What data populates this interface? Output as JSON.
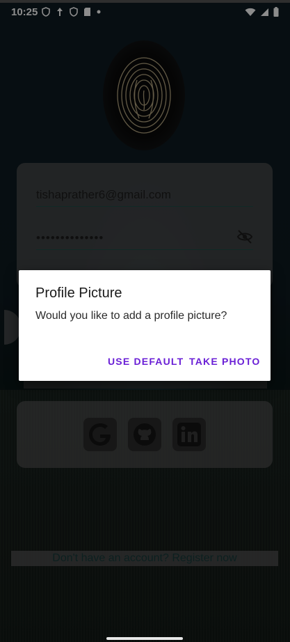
{
  "status_bar": {
    "time": "10:25",
    "left_icons": [
      "shield-icon",
      "data-saver-icon",
      "shield-icon",
      "sd-card-icon",
      "dot-icon"
    ],
    "right_icons": [
      "wifi-icon",
      "signal-icon",
      "battery-icon"
    ]
  },
  "login_form": {
    "email_value": "tishaprather6@gmail.com",
    "password_value": "••••••••••••••"
  },
  "social": {
    "buttons": [
      "google-icon",
      "github-icon",
      "linkedin-icon"
    ]
  },
  "register_link": "Don't have an account? Register now",
  "dialog": {
    "title": "Profile Picture",
    "message": "Would you like to add a profile picture?",
    "use_default_label": "USE DEFAULT",
    "take_photo_label": "TAKE PHOTO"
  },
  "colors": {
    "dialog_button": "#6a1fd6",
    "input_underline": "#1e4d45"
  }
}
